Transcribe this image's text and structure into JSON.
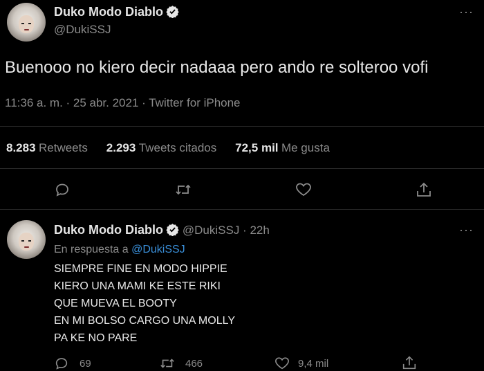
{
  "tweet": {
    "author_name": "Duko Modo Diablo",
    "author_handle": "@DukiSSJ",
    "more": "···",
    "text": "Buenooo no kiero decir nadaaa pero ando re solteroo vofi",
    "timestamp": "11:36 a. m. · 25 abr. 2021 · Twitter for iPhone",
    "stats": [
      {
        "value": "8.283",
        "label": "Retweets"
      },
      {
        "value": "2.293",
        "label": "Tweets citados"
      },
      {
        "value": "72,5 mil",
        "label": "Me gusta"
      }
    ],
    "icons": [
      "reply-icon",
      "retweet-icon",
      "like-icon",
      "share-icon"
    ]
  },
  "reply": {
    "author_name": "Duko Modo Diablo",
    "handle_time": "@DukiSSJ · 22h",
    "more": "···",
    "in_reply_prefix": "En respuesta a",
    "in_reply_handle": "@DukiSSJ",
    "lines": [
      "SIEMPRE FINE EN MODO HIPPIE",
      "KIERO UNA MAMI KE ESTE RIKI",
      "QUE MUEVA EL BOOTY",
      "EN MI BOLSO CARGO UNA MOLLY",
      "PA KE NO PARE"
    ],
    "counts": {
      "replies": "69",
      "retweets": "466",
      "likes": "9,4 mil"
    }
  },
  "colors": {
    "background": "#000000",
    "text": "#d9d9d9",
    "muted": "#8b8b8b",
    "link": "#3a8fd9",
    "verified": "#e6e6e6"
  }
}
